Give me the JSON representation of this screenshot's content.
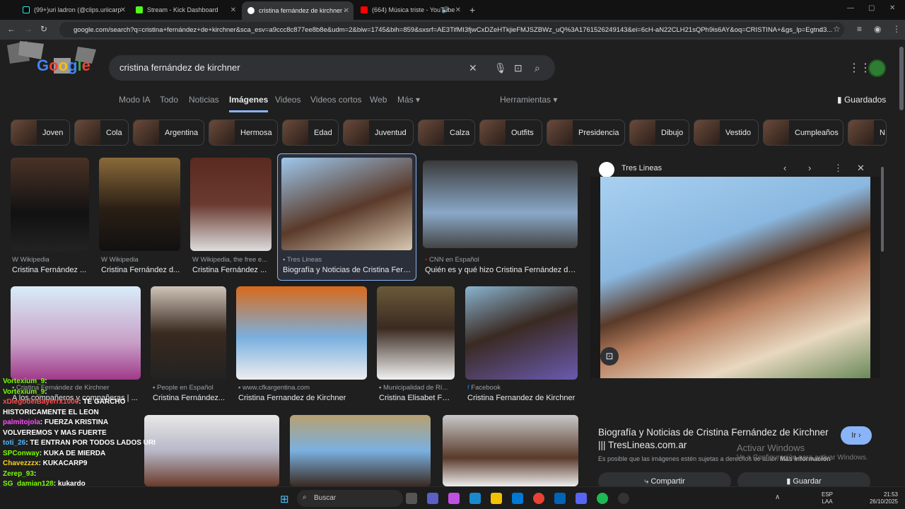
{
  "tabs": [
    {
      "label": "(99+)uri ladron (@clips.uriicarp"
    },
    {
      "label": "Stream - Kick Dashboard"
    },
    {
      "label": "cristina fernández de kirchner -"
    },
    {
      "label": "(664) Música triste - YouTube"
    }
  ],
  "url": "google.com/search?q=cristina+fernández+de+kirchner&sca_esv=a9ccc8c877ee8b8e&udm=2&biw=1745&bih=859&sxsrf=AE3TifMI3fjwCxDZeHTkjieFMJSZBWz_uQ%3A1761526249143&ei=6cH-aN22CLH21sQPh9is6AY&oq=CRISTINA+&gs_lp=Egtnd3...",
  "search": {
    "query": "cristina fernández de kirchner"
  },
  "nav": {
    "items": [
      "Modo IA",
      "Todo",
      "Noticias",
      "Imágenes",
      "Videos",
      "Videos cortos",
      "Web",
      "Más"
    ],
    "tools": "Herramientas",
    "saved": "Guardados"
  },
  "chips": [
    "Joven",
    "Cola",
    "Argentina",
    "Hermosa",
    "Edad",
    "Juventud",
    "Calza",
    "Outfits",
    "Presidencia",
    "Dibujo",
    "Vestido",
    "Cumpleaños",
    "N"
  ],
  "results": [
    {
      "source": "Wikipedia",
      "title": "Cristina Fernández ..."
    },
    {
      "source": "Wikipedia",
      "title": "Cristina Fernández d..."
    },
    {
      "source": "Wikipedia, the free e...",
      "title": "Cristina Fernández ..."
    },
    {
      "source": "Tres Lineas",
      "title": "Biografía y Noticias de Cristina Fern..."
    },
    {
      "source": "CNN en Español",
      "title": "Quién es y qué hizo Cristina Fernández de ..."
    },
    {
      "source": "Cristina Fernández de Kirchner",
      "title": "A los compañeros y compañeras | ..."
    },
    {
      "source": "People en Español",
      "title": "Cristina Fernández..."
    },
    {
      "source": "www.cfkargentina.com",
      "title": "Cristina Fernandez de Kirchner"
    },
    {
      "source": "Municipalidad de Rí...",
      "title": "Cristina Elisabet Fe..."
    },
    {
      "source": "Facebook",
      "title": "Cristina Fernandez de Kirchner"
    }
  ],
  "panel": {
    "site": "Tres Lineas",
    "title": "Biografía y Noticias de Cristina Fernández de Kirchner ||| TresLineas.com.ar",
    "go": "Ir",
    "notice": "Es posible que las imágenes estén sujetas a derechos de autor.",
    "more": "Más información",
    "share": "Compartir",
    "save": "Guardar"
  },
  "watermark": {
    "line1": "Activar Windows",
    "line2": "Ve a Configuración para activar Windows."
  },
  "chat": [
    {
      "user": "Vortexium_9",
      "text": ":",
      "color": "#7CFC00"
    },
    {
      "user": "Vortexium_9",
      "text": ":",
      "color": "#7CFC00"
    },
    {
      "user": "xDiegodelBayerrx1000",
      "text": ": TE GARCHO HISTORICAMENTE EL LEON",
      "color": "#ff4d4d"
    },
    {
      "user": "palmitojola",
      "text": ": FUERZA KRISTINA VOLVEREMOS Y MAS FUERTE",
      "color": "#ff4dff"
    },
    {
      "user": "toti_26",
      "text": ": TE ENTRAN POR TODOS LADOS URI",
      "color": "#4db8ff"
    },
    {
      "user": "SPConway",
      "text": ": KUKA DE MIERDA",
      "color": "#7CFC00"
    },
    {
      "user": "Chavezzzx",
      "text": ": KUKACARP9",
      "color": "#ffd11a"
    },
    {
      "user": "Zerep_93",
      "text": ":",
      "color": "#7CFC00"
    },
    {
      "user": "SG_damian128",
      "text": ": kukardo",
      "color": "#7CFC00"
    }
  ],
  "taskbar": {
    "search": "Buscar",
    "lang1": "ESP",
    "lang2": "LAA",
    "time": "21:53",
    "date": "26/10/2025"
  },
  "colors": {
    "accent": "#8ab4f8",
    "bg": "#1f1f1f"
  }
}
